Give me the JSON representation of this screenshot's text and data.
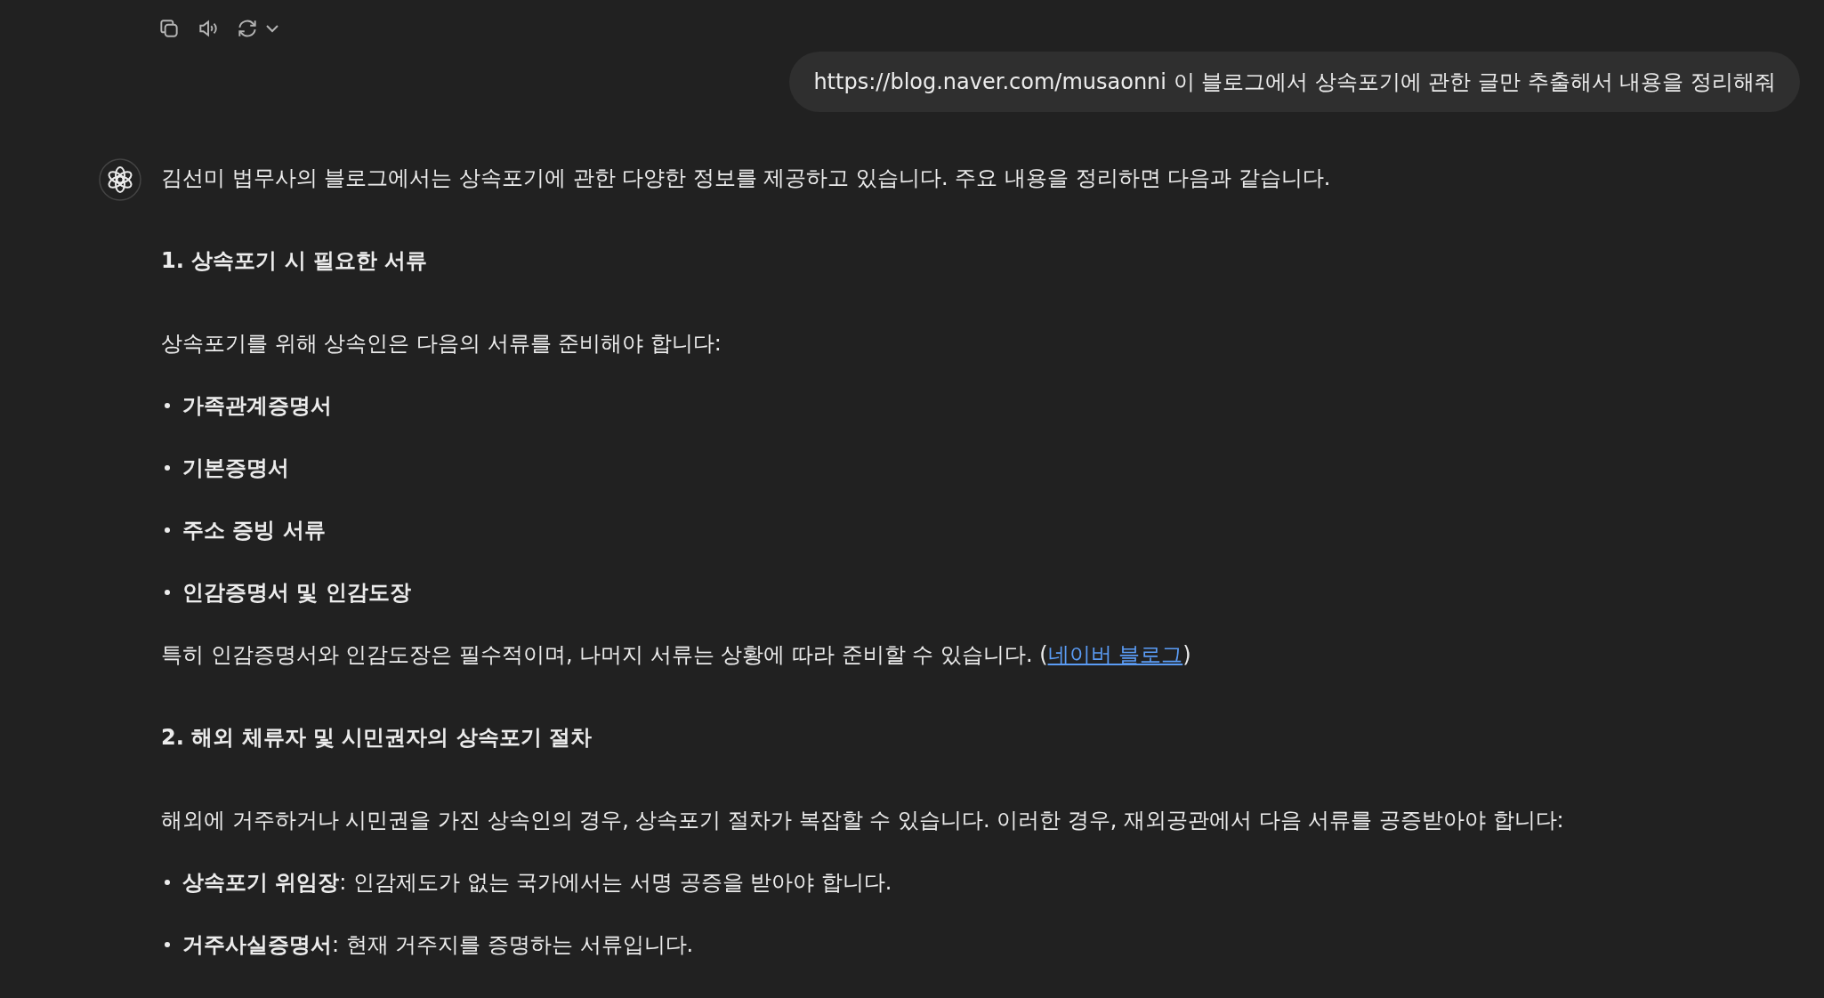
{
  "user_message": {
    "text": "https://blog.naver.com/musaonni 이 블로그에서 상속포기에 관한 글만 추출해서 내용을 정리해줘"
  },
  "assistant": {
    "blocks": [
      {
        "kind": "paragraph",
        "text": "김선미 법무사의 블로그에서는 상속포기에 관한 다양한 정보를 제공하고 있습니다. 주요 내용을 정리하면 다음과 같습니다."
      },
      {
        "kind": "heading",
        "text": "1. 상속포기 시 필요한 서류"
      },
      {
        "kind": "paragraph",
        "text": "상속포기를 위해 상속인은 다음의 서류를 준비해야 합니다:"
      },
      {
        "kind": "bullet",
        "text": "가족관계증명서",
        "bold": true
      },
      {
        "kind": "bullet",
        "text": "기본증명서",
        "bold": true
      },
      {
        "kind": "bullet",
        "text": "주소 증빙 서류",
        "bold": true
      },
      {
        "kind": "bullet",
        "text": "인감증명서 및 인감도장",
        "bold": true
      },
      {
        "kind": "paragraph",
        "text": "특히 인감증명서와 인감도장은 필수적이며, 나머지 서류는 상황에 따라 준비할 수 있습니다. (",
        "link": "네이버 블로그",
        "after": ")"
      },
      {
        "kind": "heading",
        "text": "2. 해외 체류자 및 시민권자의 상속포기 절차"
      },
      {
        "kind": "paragraph",
        "text": "해외에 거주하거나 시민권을 가진 상속인의 경우, 상속포기 절차가 복잡할 수 있습니다. 이러한 경우, 재외공관에서 다음 서류를 공증받아야 합니다:"
      },
      {
        "kind": "bullet",
        "text": "**상속포기 위임장**: 인감제도가 없는 국가에서는 서명 공증을 받아야 합니다.",
        "bold": false
      },
      {
        "kind": "bullet",
        "text": "**거주사실증명서**: 현재 거주지를 증명하는 서류입니다.",
        "bold": false
      }
    ]
  }
}
